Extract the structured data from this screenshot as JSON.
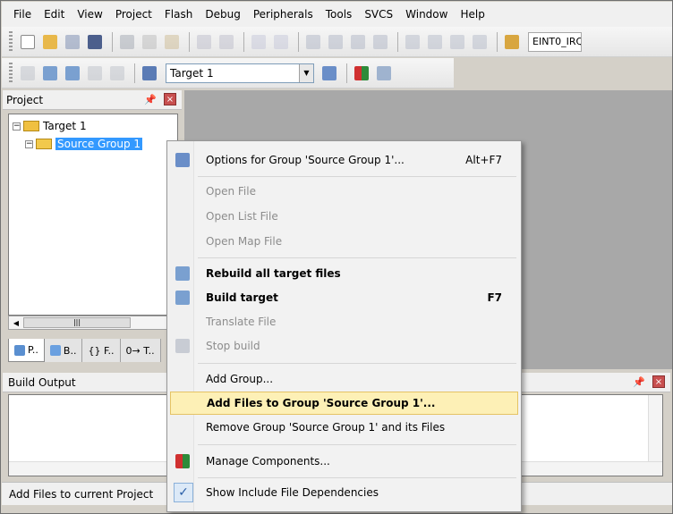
{
  "menu": [
    "File",
    "Edit",
    "View",
    "Project",
    "Flash",
    "Debug",
    "Peripherals",
    "Tools",
    "SVCS",
    "Window",
    "Help"
  ],
  "toolbar": {
    "eint_label": "EINT0_IRQ",
    "target_combo": "Target 1"
  },
  "project_pane": {
    "title": "Project",
    "root": "Target 1",
    "group": "Source Group 1",
    "tabs": [
      "P..",
      "B..",
      "{} F..",
      "0→ T.."
    ]
  },
  "build_output": {
    "title": "Build Output"
  },
  "status": "Add Files to current Project",
  "context_menu": {
    "items": [
      {
        "label": "Options for Group 'Source Group 1'...",
        "shortcut": "Alt+F7",
        "state": "normal"
      },
      {
        "label": "Open File",
        "state": "disabled"
      },
      {
        "label": "Open List File",
        "state": "disabled"
      },
      {
        "label": "Open Map File",
        "state": "disabled"
      },
      {
        "label": "Rebuild all target files",
        "state": "bold"
      },
      {
        "label": "Build target",
        "shortcut": "F7",
        "state": "bold"
      },
      {
        "label": "Translate File",
        "state": "disabled"
      },
      {
        "label": "Stop build",
        "state": "disabled"
      },
      {
        "label": "Add Group...",
        "state": "normal"
      },
      {
        "label": "Add Files to Group 'Source Group 1'...",
        "state": "highlighted"
      },
      {
        "label": "Remove Group 'Source Group 1' and its Files",
        "state": "normal"
      },
      {
        "label": "Manage Components...",
        "state": "normal"
      },
      {
        "label": "Show Include File Dependencies",
        "state": "checked"
      }
    ]
  }
}
